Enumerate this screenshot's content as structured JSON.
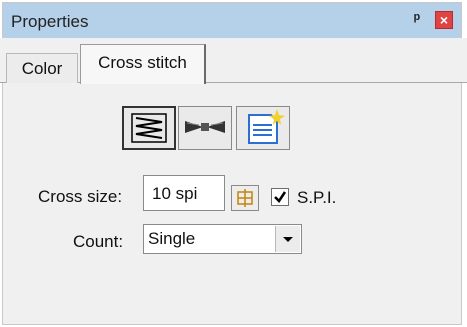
{
  "window": {
    "title": "Properties"
  },
  "tabs": [
    {
      "label": "Color"
    },
    {
      "label": "Cross stitch"
    }
  ],
  "toolbar": {
    "buttons": [
      {
        "icon": "zigzag-stitch-icon",
        "selected": true
      },
      {
        "icon": "bowtie-stitch-icon",
        "selected": false
      },
      {
        "icon": "document-icon",
        "selected": false
      }
    ]
  },
  "cross_size": {
    "label": "Cross size:",
    "value": "10 spi"
  },
  "spi": {
    "label": "S.P.I.",
    "checked": true
  },
  "count": {
    "label": "Count:",
    "value": "Single"
  },
  "colors": {
    "titlebar": "#b5d1ea",
    "close": "#e04343",
    "doc_icon": "#2a6fd1",
    "doc_sparkle": "#f2d12a"
  }
}
